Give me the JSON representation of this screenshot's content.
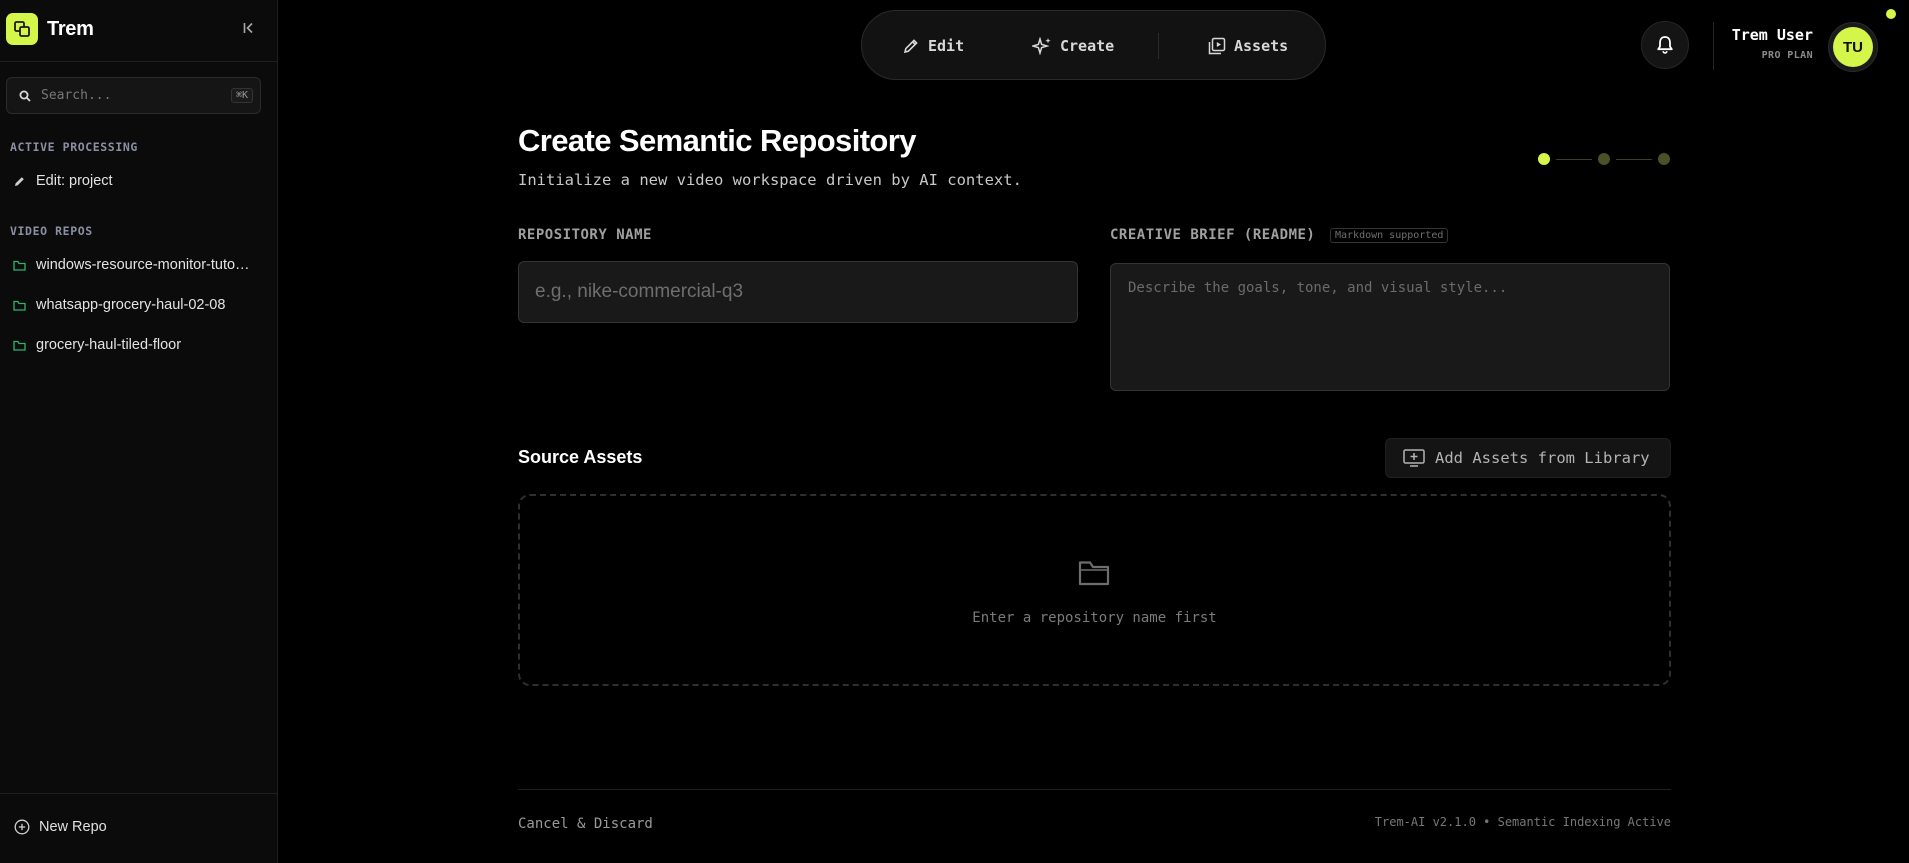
{
  "app": {
    "name": "Trem"
  },
  "sidebar": {
    "search": {
      "placeholder": "Search...",
      "shortcut": "⌘K"
    },
    "sections": [
      {
        "label": "ACTIVE PROCESSING",
        "items": [
          {
            "label": "Edit: project",
            "icon": "pencil-icon"
          }
        ]
      },
      {
        "label": "VIDEO REPOS",
        "items": [
          {
            "label": "windows-resource-monitor-tutorial",
            "icon": "folder-icon"
          },
          {
            "label": "whatsapp-grocery-haul-02-08",
            "icon": "folder-icon"
          },
          {
            "label": "grocery-haul-tiled-floor",
            "icon": "folder-icon"
          }
        ]
      }
    ],
    "new_repo_label": "New Repo"
  },
  "topnav": {
    "items": [
      {
        "label": "Edit",
        "icon": "pencil-icon"
      },
      {
        "label": "Create",
        "icon": "sparkles-icon"
      },
      {
        "label": "Assets",
        "icon": "media-library-icon"
      }
    ]
  },
  "user": {
    "name": "Trem User",
    "plan": "PRO PLAN",
    "initials": "TU"
  },
  "page": {
    "title": "Create Semantic Repository",
    "subtitle": "Initialize a new video workspace driven by AI context.",
    "steps": {
      "total": 3,
      "current": 1
    }
  },
  "form": {
    "repo_name": {
      "label": "REPOSITORY NAME",
      "placeholder": "e.g., nike-commercial-q3",
      "value": ""
    },
    "brief": {
      "label": "CREATIVE BRIEF (README)",
      "badge": "Markdown supported",
      "placeholder": "Describe the goals, tone, and visual style...",
      "value": ""
    }
  },
  "assets": {
    "title": "Source Assets",
    "add_label": "Add Assets from Library",
    "empty_text": "Enter a repository name first"
  },
  "footer": {
    "cancel_label": "Cancel & Discard",
    "version_text": "Trem-AI v2.1.0 • Semantic Indexing Active"
  },
  "colors": {
    "accent": "#d4f54a",
    "background": "#000000",
    "sidebar": "#0b0b0b",
    "repo_icon": "#2fb36b"
  }
}
